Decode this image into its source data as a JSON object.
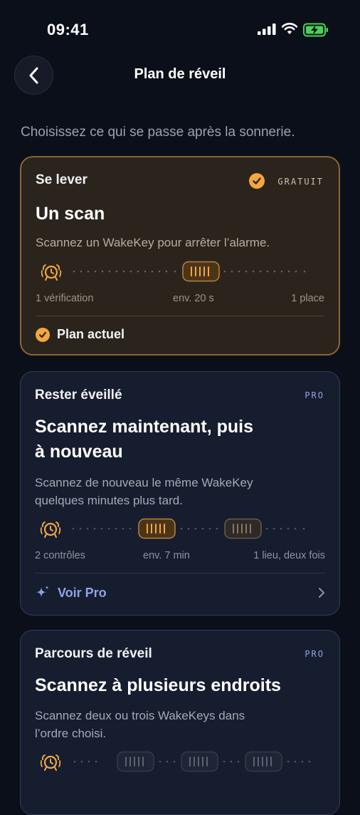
{
  "status": {
    "time": "09:41"
  },
  "header": {
    "title": "Plan de réveil"
  },
  "intro": "Choisissez ce qui se passe après la sonnerie.",
  "cards": [
    {
      "tag": "Se lever",
      "badge": "GRATUIT",
      "title": "Un scan",
      "desc": "Scannez un WakeKey pour arrêter l’alarme.",
      "meta": [
        "1 vérification",
        "env. 20 s",
        "1 place"
      ],
      "footer": "Plan actuel"
    },
    {
      "tag": "Rester éveillé",
      "badge": "PRO",
      "title_lines": [
        "Scannez maintenant, puis",
        "à nouveau"
      ],
      "desc_lines": [
        "Scannez de nouveau le même WakeKey",
        "quelques minutes plus tard."
      ],
      "meta": [
        "2 contrôles",
        "env. 7 min",
        "1 lieu, deux fois"
      ],
      "footer": "Voir Pro"
    },
    {
      "tag": "Parcours de réveil",
      "badge": "PRO",
      "title": "Scannez à plusieurs endroits",
      "desc_lines": [
        "Scannez deux ou trois WakeKeys dans",
        "l’ordre choisi."
      ]
    }
  ],
  "colors": {
    "accent": "#f2a742",
    "pro": "#8ea3e6",
    "background": "#0b0f19"
  },
  "icons": [
    "chevron-left-icon",
    "alarm-clock-icon",
    "wakekey-icon",
    "finish-flag-icon",
    "sparkle-icon",
    "chevron-right-icon",
    "check-circle-icon"
  ]
}
